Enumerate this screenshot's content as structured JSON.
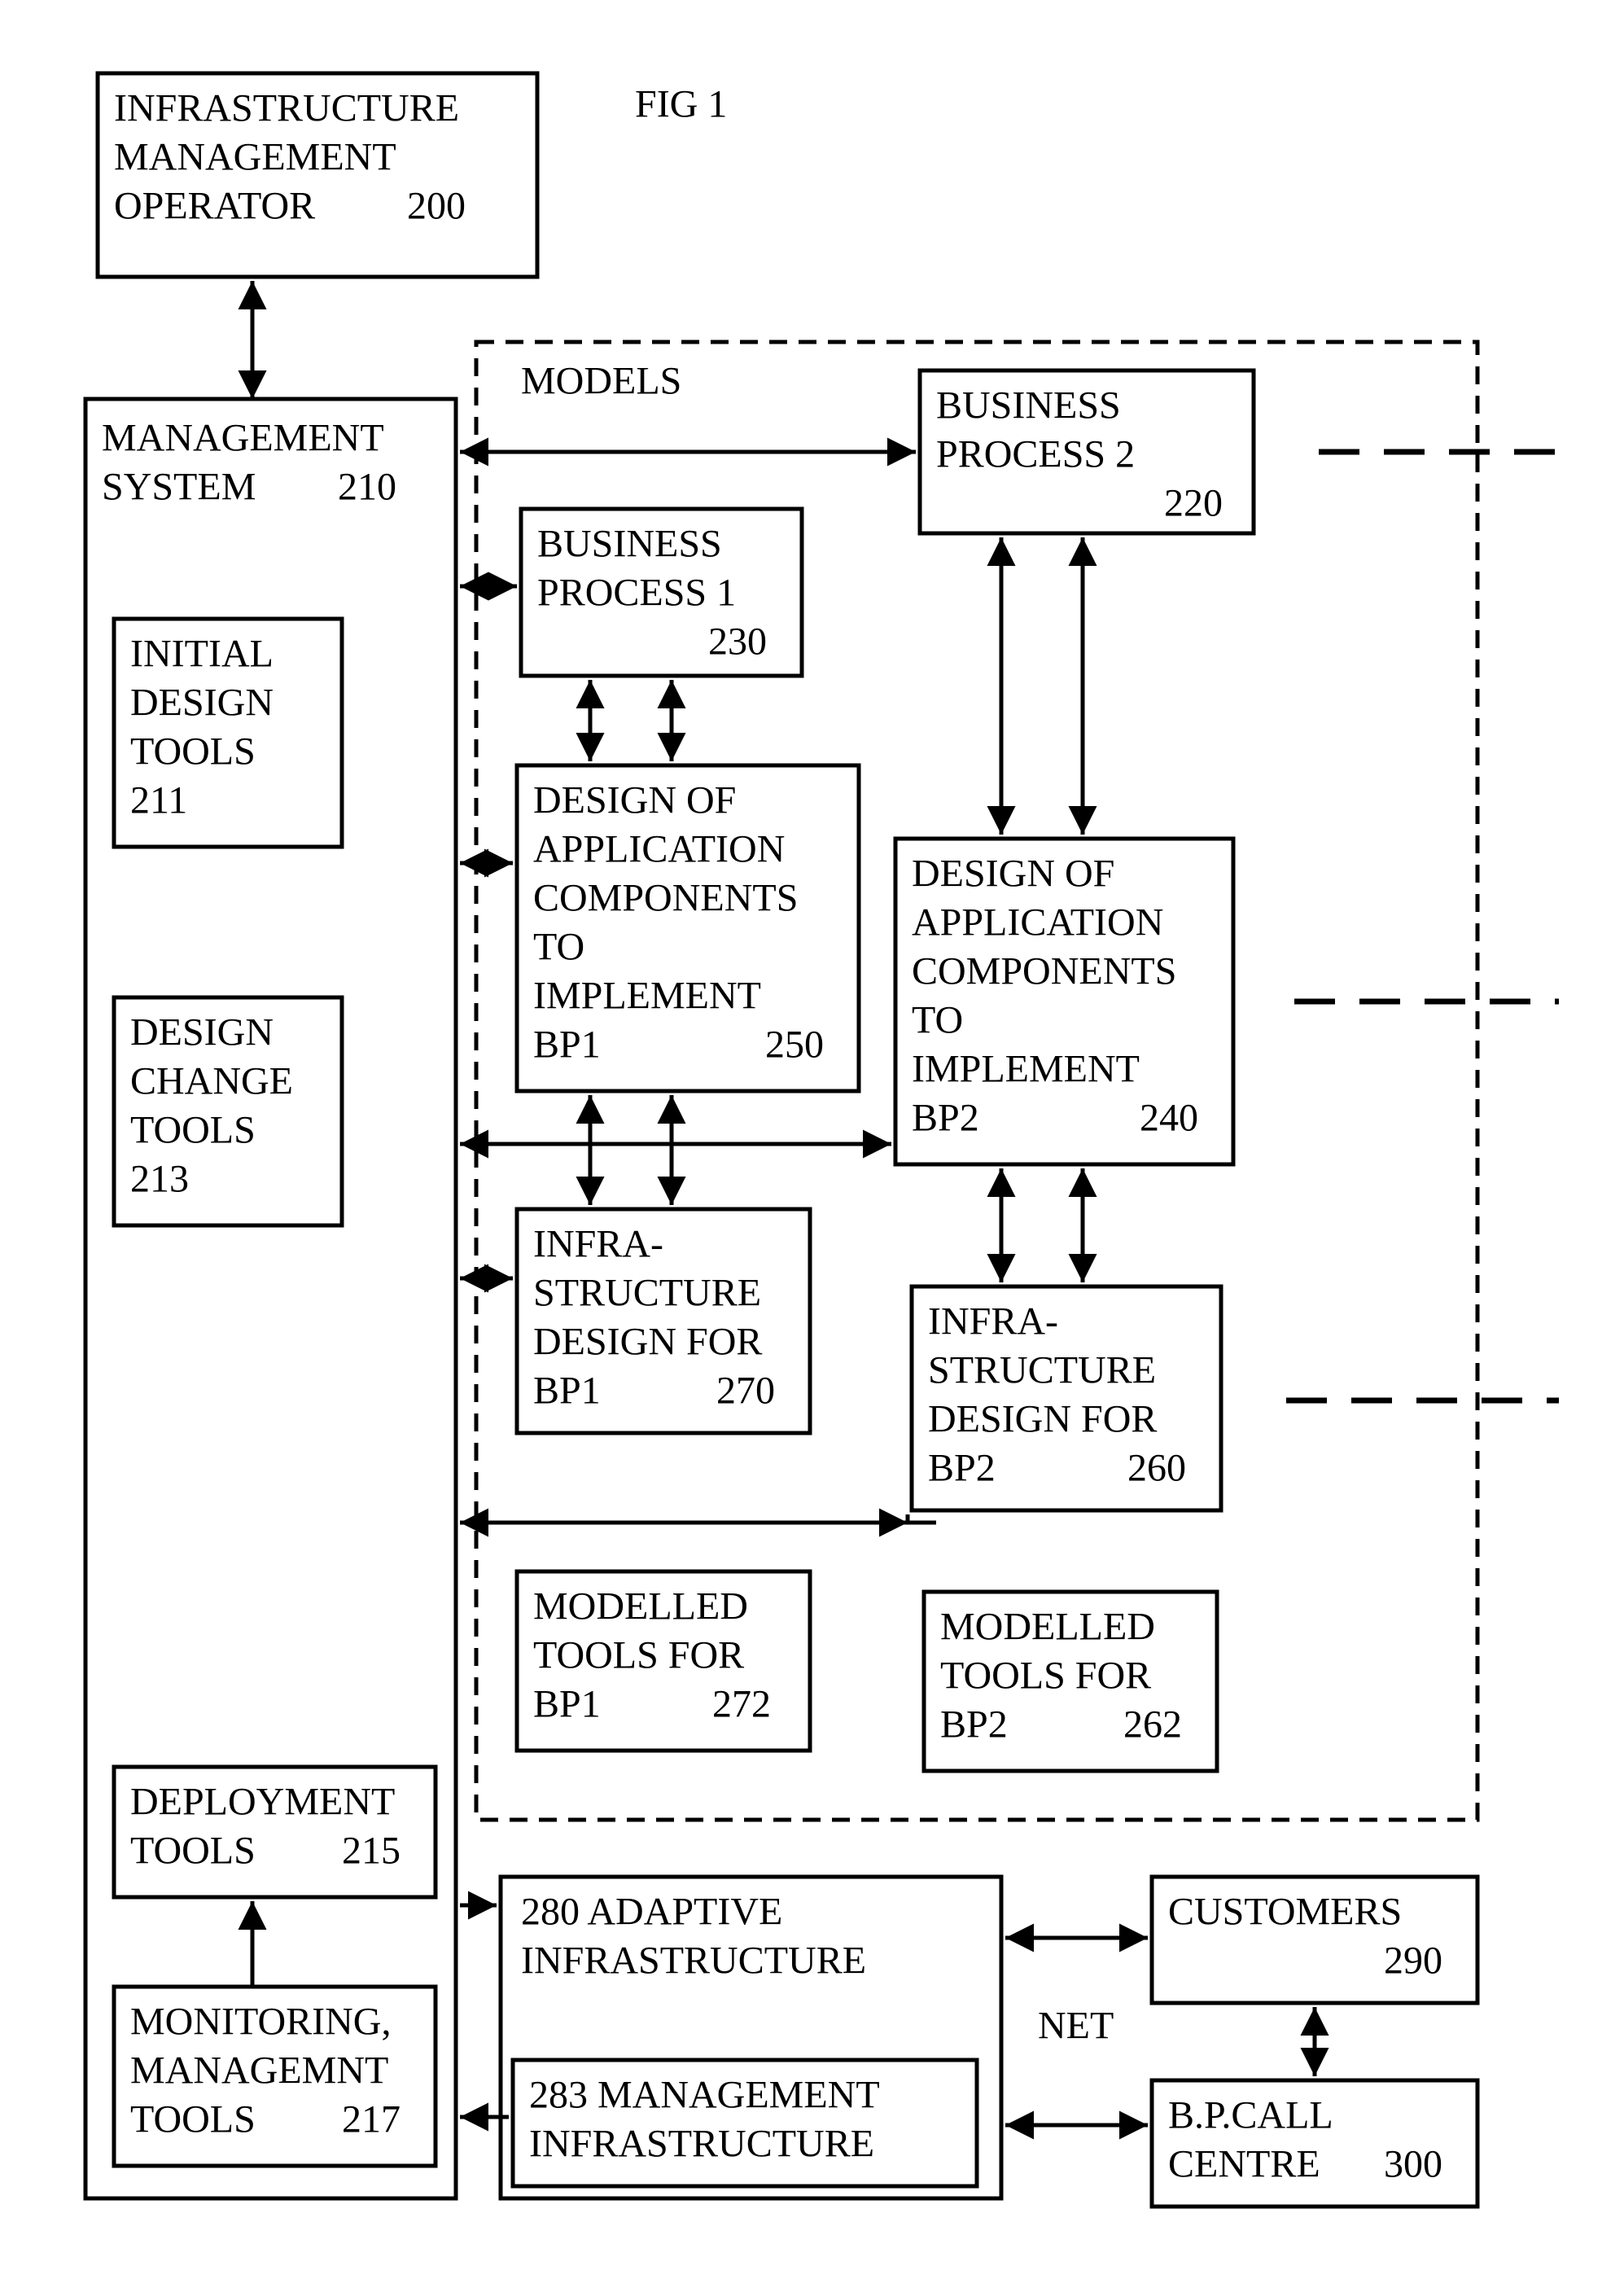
{
  "fig": "FIG 1",
  "models": "MODELS",
  "net": "NET",
  "n200a": "INFRASTRUCTURE",
  "n200b": "MANAGEMENT",
  "n200c": "OPERATOR",
  "n200d": "200",
  "n210a": "MANAGEMENT",
  "n210b": "SYSTEM",
  "n210c": "210",
  "n211a": "INITIAL",
  "n211b": "DESIGN",
  "n211c": "TOOLS",
  "n211d": "211",
  "n213a": "DESIGN",
  "n213b": "CHANGE",
  "n213c": "TOOLS",
  "n213d": "213",
  "n215a": "DEPLOYMENT",
  "n215b": "TOOLS",
  "n215c": "215",
  "n217a": "MONITORING,",
  "n217b": "MANAGEMNT",
  "n217c": "TOOLS",
  "n217d": "217",
  "n220a": "BUSINESS",
  "n220b": "PROCESS 2",
  "n220c": "220",
  "n230a": "BUSINESS",
  "n230b": "PROCESS 1",
  "n230c": "230",
  "n250a": "DESIGN OF",
  "n250b": "APPLICATION",
  "n250c": "COMPONENTS",
  "n250d": "TO",
  "n250e": "IMPLEMENT",
  "n250f": "BP1",
  "n250g": "250",
  "n240a": "DESIGN OF",
  "n240b": "APPLICATION",
  "n240c": "COMPONENTS",
  "n240d": "TO",
  "n240e": "IMPLEMENT",
  "n240f": "BP2",
  "n240g": "240",
  "n270a": "INFRA-",
  "n270b": "STRUCTURE",
  "n270c": "DESIGN FOR",
  "n270d": "BP1",
  "n270e": "270",
  "n260a": "INFRA-",
  "n260b": "STRUCTURE",
  "n260c": "DESIGN FOR",
  "n260d": "BP2",
  "n260e": "260",
  "n272a": "MODELLED",
  "n272b": "TOOLS FOR",
  "n272c": "BP1",
  "n272d": "272",
  "n262a": "MODELLED",
  "n262b": "TOOLS FOR",
  "n262c": "BP2",
  "n262d": "262",
  "n280a": "280 ADAPTIVE",
  "n280b": "INFRASTRUCTURE",
  "n283a": "283 MANAGEMENT",
  "n283b": "INFRASTRUCTURE",
  "n290a": "CUSTOMERS",
  "n290b": "290",
  "n300a": "B.P.CALL",
  "n300b": "CENTRE",
  "n300c": "300"
}
